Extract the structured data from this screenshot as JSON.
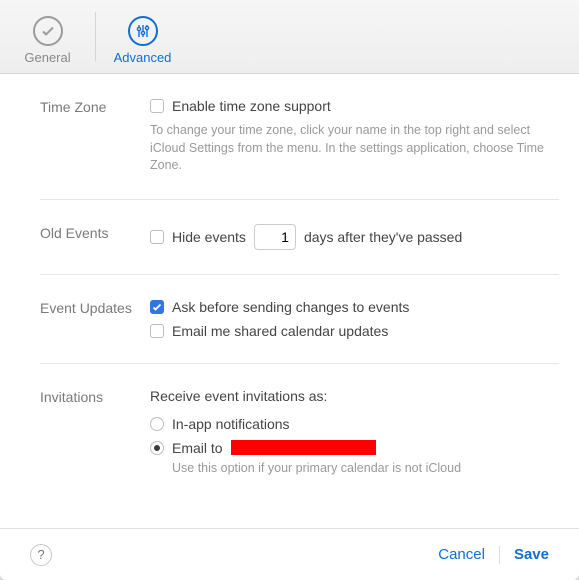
{
  "tabs": {
    "general": "General",
    "advanced": "Advanced"
  },
  "sections": {
    "timezone": {
      "label": "Time Zone",
      "enable_label": "Enable time zone support",
      "enable_checked": false,
      "help": "To change your time zone, click your name in the top right and select iCloud Settings from the menu. In the settings application, choose Time Zone."
    },
    "old_events": {
      "label": "Old Events",
      "hide_checked": false,
      "hide_prefix": "Hide events",
      "hide_days_value": "1",
      "hide_suffix": "days after they've passed"
    },
    "event_updates": {
      "label": "Event Updates",
      "ask_label": "Ask before sending changes to events",
      "ask_checked": true,
      "email_label": "Email me shared calendar updates",
      "email_checked": false
    },
    "invitations": {
      "label": "Invitations",
      "heading": "Receive event invitations as:",
      "inapp_label": "In-app notifications",
      "inapp_selected": false,
      "emailto_prefix": "Email to",
      "emailto_selected": true,
      "help": "Use this option if your primary calendar is not iCloud"
    }
  },
  "footer": {
    "help_glyph": "?",
    "cancel": "Cancel",
    "save": "Save"
  }
}
